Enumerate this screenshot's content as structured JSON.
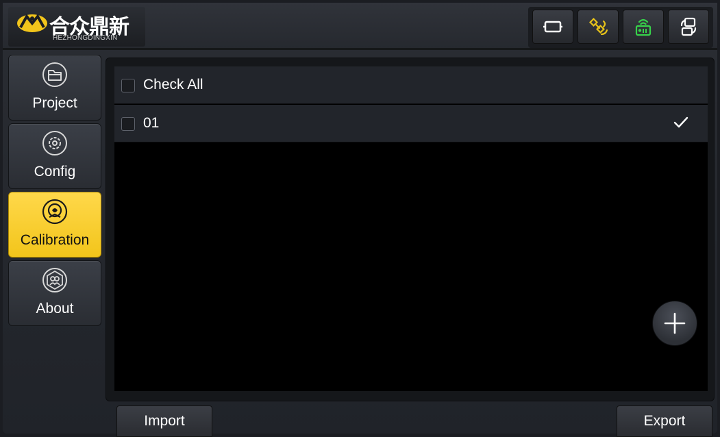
{
  "brand": {
    "name_cn": "合众鼎新",
    "name_en": "HEZHONGDINGXIN"
  },
  "status_icons": [
    "screen-frame-icon",
    "satellite-icon",
    "radio-station-icon",
    "switch-device-icon"
  ],
  "status_colors": {
    "satellite": "#e6c21a",
    "radio": "#37d34b"
  },
  "sidebar": {
    "items": [
      {
        "label": "Project",
        "icon": "folder-icon",
        "active": false
      },
      {
        "label": "Config",
        "icon": "settings-icon",
        "active": false
      },
      {
        "label": "Calibration",
        "icon": "calibration-icon",
        "active": true
      },
      {
        "label": "About",
        "icon": "about-icon",
        "active": false
      }
    ]
  },
  "list": {
    "check_all_label": "Check All",
    "rows": [
      {
        "name": "01",
        "selected": true
      }
    ]
  },
  "actions": {
    "import_label": "Import",
    "export_label": "Export"
  },
  "accent_color": "#f5c820"
}
